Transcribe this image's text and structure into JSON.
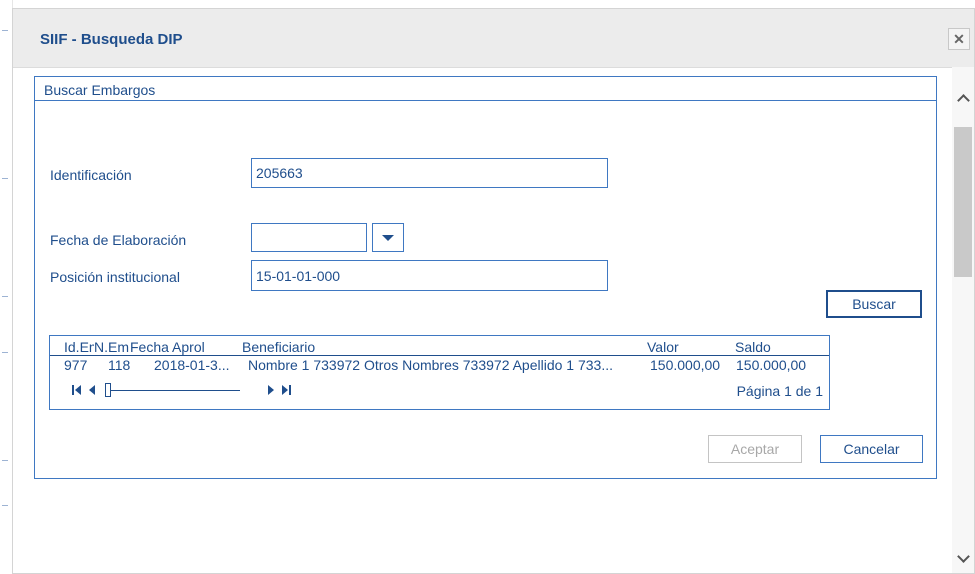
{
  "dialog": {
    "title": "SIIF - Busqueda DIP",
    "close_icon": "close-icon"
  },
  "panel": {
    "title": "Buscar Embargos"
  },
  "form": {
    "identificacion_label": "Identificación",
    "identificacion_value": "205663",
    "fecha_label": "Fecha de Elaboración",
    "fecha_value": "",
    "posicion_label": "Posición institucional",
    "posicion_value": "15-01-01-000"
  },
  "buttons": {
    "buscar": "Buscar",
    "aceptar": "Aceptar",
    "cancelar": "Cancelar"
  },
  "grid": {
    "columns": [
      "Id.Em",
      "N.Em",
      "Fecha Aprol",
      "Beneficiario",
      "Valor",
      "Saldo"
    ],
    "rows": [
      {
        "id_em": "977",
        "n_em": "118",
        "fecha": "2018-01-3...",
        "beneficiario": "Nombre 1 733972 Otros Nombres 733972 Apellido 1 733...",
        "valor": "150.000,00",
        "saldo": "150.000,00"
      }
    ],
    "page_info": "Página 1 de 1"
  },
  "colors": {
    "primary": "#1f4e8c",
    "border": "#3f78c2",
    "titlebar": "#ececec",
    "disabled": "#a8a8a8"
  }
}
